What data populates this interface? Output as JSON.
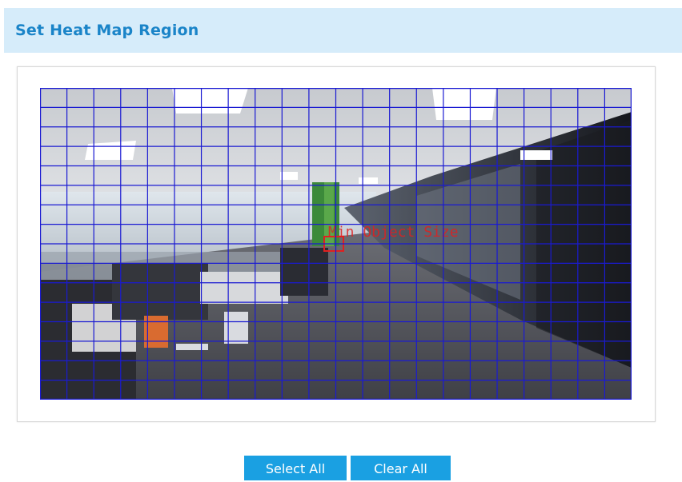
{
  "header": {
    "title": "Set Heat Map Region"
  },
  "video": {
    "overlay_text": "Min Object Size",
    "grid_color": "#1a1ad2",
    "min_object_color": "#e02020"
  },
  "grid": {
    "columns": 22,
    "rows": 16
  },
  "actions": {
    "select_all_label": "Select All",
    "clear_all_label": "Clear All"
  },
  "colors": {
    "accent": "#1aa0e2",
    "header_bg": "#d6ecfa",
    "title": "#1a84c8"
  }
}
